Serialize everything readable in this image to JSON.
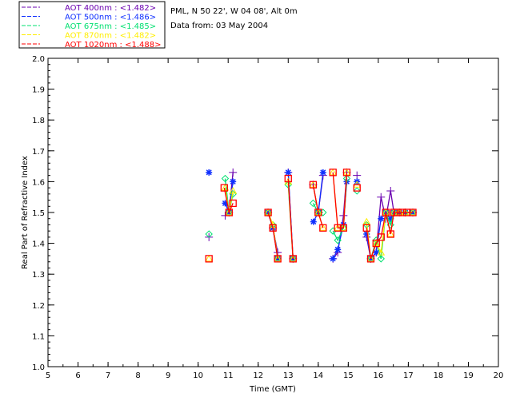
{
  "header": {
    "site": "PML, N 50 22', W 04 08', Alt 0m",
    "date": "Data from: 03 May 2004"
  },
  "chart_data": {
    "type": "scatter",
    "xlabel": "Time (GMT)",
    "ylabel": "Real Part of Refractive Index",
    "xlim": [
      5,
      20
    ],
    "ylim": [
      1.0,
      2.0
    ],
    "xticks": [
      "5",
      "6",
      "7",
      "8",
      "9",
      "10",
      "11",
      "12",
      "13",
      "14",
      "15",
      "16",
      "17",
      "18",
      "19",
      "20"
    ],
    "yticks": [
      "1.0",
      "1.1",
      "1.2",
      "1.3",
      "1.4",
      "1.5",
      "1.6",
      "1.7",
      "1.8",
      "1.9",
      "2.0"
    ],
    "grid": false,
    "legend_placement": "top-left outside",
    "series": [
      {
        "name": "AOT  400nm : <1.482>",
        "color": "#6a00b0",
        "marker": "plus",
        "points": [
          [
            10.36,
            1.42
          ],
          null,
          [
            10.9,
            1.49
          ],
          [
            11.03,
            1.5
          ],
          [
            11.16,
            1.63
          ],
          null,
          [
            12.33,
            1.5
          ],
          [
            12.49,
            1.45
          ],
          [
            12.65,
            1.37
          ],
          null,
          [
            13.0,
            1.63
          ],
          [
            13.16,
            1.35
          ],
          null,
          [
            13.83,
            1.59
          ],
          [
            14.0,
            1.5
          ],
          [
            14.16,
            1.62
          ],
          null,
          [
            14.49,
            1.35
          ],
          [
            14.65,
            1.37
          ],
          [
            14.84,
            1.49
          ],
          [
            14.95,
            1.63
          ],
          null,
          [
            15.29,
            1.62
          ],
          null,
          [
            15.61,
            1.42
          ],
          [
            15.75,
            1.35
          ],
          [
            15.93,
            1.37
          ],
          [
            16.09,
            1.55
          ],
          [
            16.25,
            1.48
          ],
          [
            16.41,
            1.57
          ],
          [
            16.52,
            1.5
          ],
          [
            16.7,
            1.5
          ],
          [
            16.9,
            1.5
          ],
          [
            17.15,
            1.5
          ]
        ]
      },
      {
        "name": "AOT  500nm : <1.486>",
        "color": "#1030ff",
        "marker": "asterisk",
        "points": [
          [
            10.36,
            1.63
          ],
          null,
          [
            10.9,
            1.53
          ],
          [
            11.03,
            1.5
          ],
          [
            11.16,
            1.6
          ],
          null,
          [
            12.33,
            1.5
          ],
          [
            12.49,
            1.45
          ],
          [
            12.65,
            1.35
          ],
          null,
          [
            13.0,
            1.63
          ],
          [
            13.16,
            1.35
          ],
          null,
          [
            13.84,
            1.47
          ],
          [
            14.0,
            1.5
          ],
          [
            14.16,
            1.63
          ],
          null,
          [
            14.49,
            1.35
          ],
          [
            14.65,
            1.38
          ],
          [
            14.84,
            1.46
          ],
          [
            14.95,
            1.6
          ],
          null,
          [
            15.29,
            1.6
          ],
          null,
          [
            15.61,
            1.43
          ],
          [
            15.75,
            1.35
          ],
          [
            15.93,
            1.37
          ],
          [
            16.09,
            1.48
          ],
          [
            16.25,
            1.5
          ],
          [
            16.41,
            1.48
          ],
          [
            16.52,
            1.5
          ],
          [
            16.7,
            1.5
          ],
          [
            16.9,
            1.5
          ],
          [
            17.15,
            1.5
          ]
        ]
      },
      {
        "name": "AOT  675nm : <1.485>",
        "color": "#00e070",
        "marker": "diamond",
        "points": [
          [
            10.36,
            1.43
          ],
          null,
          [
            10.9,
            1.61
          ],
          [
            11.03,
            1.5
          ],
          [
            11.16,
            1.56
          ],
          null,
          [
            12.33,
            1.5
          ],
          [
            12.49,
            1.46
          ],
          [
            12.65,
            1.35
          ],
          null,
          [
            13.0,
            1.59
          ],
          [
            13.16,
            1.35
          ],
          null,
          [
            13.83,
            1.53
          ],
          [
            14.0,
            1.5
          ],
          [
            14.16,
            1.5
          ],
          null,
          [
            14.49,
            1.44
          ],
          [
            14.65,
            1.41
          ],
          [
            14.84,
            1.45
          ],
          [
            14.95,
            1.61
          ],
          null,
          [
            15.29,
            1.57
          ],
          null,
          [
            15.61,
            1.46
          ],
          [
            15.75,
            1.35
          ],
          [
            15.93,
            1.41
          ],
          [
            16.09,
            1.35
          ],
          [
            16.25,
            1.5
          ],
          [
            16.41,
            1.46
          ],
          [
            16.52,
            1.5
          ],
          [
            16.7,
            1.5
          ],
          [
            16.9,
            1.5
          ],
          [
            17.15,
            1.5
          ]
        ]
      },
      {
        "name": "AOT  870nm : <1.482>",
        "color": "#ffee00",
        "marker": "triangle",
        "points": [
          [
            10.36,
            1.35
          ],
          null,
          [
            10.9,
            1.58
          ],
          [
            11.03,
            1.5
          ],
          [
            11.16,
            1.57
          ],
          null,
          [
            12.33,
            1.5
          ],
          [
            12.49,
            1.46
          ],
          [
            12.65,
            1.35
          ],
          null,
          [
            13.0,
            1.6
          ],
          [
            13.16,
            1.35
          ],
          null,
          [
            13.83,
            1.59
          ],
          [
            14.0,
            1.5
          ],
          [
            14.16,
            1.45
          ],
          null,
          [
            14.49,
            1.63
          ],
          [
            14.65,
            1.45
          ],
          [
            14.84,
            1.45
          ],
          [
            14.95,
            1.63
          ],
          null,
          [
            15.29,
            1.59
          ],
          null,
          [
            15.61,
            1.47
          ],
          [
            15.75,
            1.35
          ],
          [
            15.93,
            1.4
          ],
          [
            16.09,
            1.37
          ],
          [
            16.25,
            1.5
          ],
          [
            16.41,
            1.43
          ],
          [
            16.52,
            1.5
          ],
          [
            16.7,
            1.5
          ],
          [
            16.9,
            1.5
          ],
          [
            17.15,
            1.5
          ]
        ]
      },
      {
        "name": "AOT 1020nm : <1.488>",
        "color": "#ff0000",
        "marker": "square",
        "points": [
          [
            10.36,
            1.35
          ],
          null,
          [
            10.87,
            1.58
          ],
          [
            11.03,
            1.5
          ],
          [
            11.16,
            1.53
          ],
          null,
          [
            12.33,
            1.5
          ],
          [
            12.49,
            1.45
          ],
          [
            12.65,
            1.35
          ],
          null,
          [
            13.0,
            1.61
          ],
          [
            13.16,
            1.35
          ],
          null,
          [
            13.83,
            1.59
          ],
          [
            14.0,
            1.5
          ],
          [
            14.16,
            1.45
          ],
          null,
          [
            14.49,
            1.63
          ],
          [
            14.65,
            1.45
          ],
          [
            14.84,
            1.45
          ],
          [
            14.95,
            1.63
          ],
          null,
          [
            15.29,
            1.58
          ],
          null,
          [
            15.61,
            1.45
          ],
          [
            15.75,
            1.35
          ],
          [
            15.93,
            1.4
          ],
          [
            16.09,
            1.42
          ],
          [
            16.25,
            1.5
          ],
          [
            16.41,
            1.43
          ],
          [
            16.52,
            1.5
          ],
          [
            16.65,
            1.5
          ],
          [
            16.8,
            1.5
          ],
          [
            16.95,
            1.5
          ],
          [
            17.15,
            1.5
          ]
        ]
      }
    ]
  }
}
